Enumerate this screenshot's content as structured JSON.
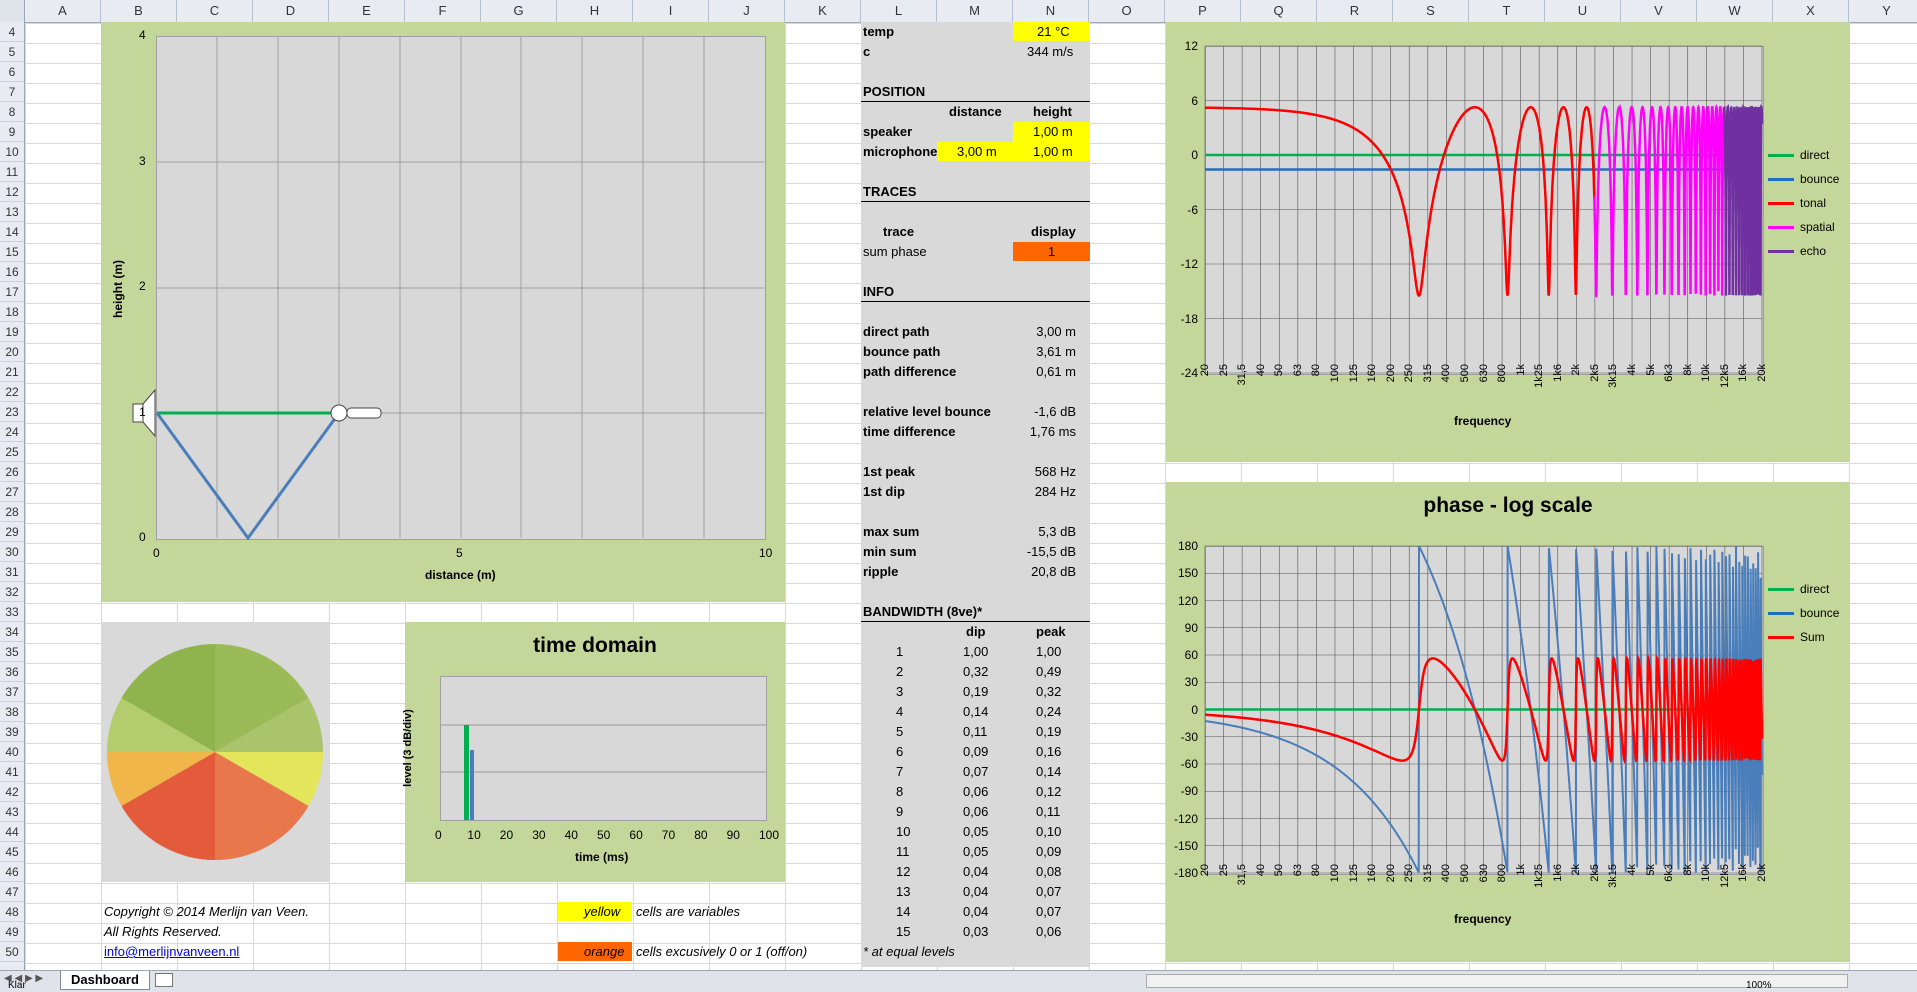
{
  "columns": [
    "A",
    "B",
    "C",
    "D",
    "E",
    "F",
    "G",
    "H",
    "I",
    "J",
    "K",
    "L",
    "M",
    "N",
    "O",
    "P",
    "Q",
    "R",
    "S",
    "T",
    "U",
    "V",
    "W",
    "X",
    "Y"
  ],
  "rows": [
    "4",
    "5",
    "6",
    "7",
    "8",
    "9",
    "10",
    "11",
    "12",
    "13",
    "14",
    "15",
    "16",
    "17",
    "18",
    "19",
    "20",
    "21",
    "22",
    "23",
    "24",
    "25",
    "26",
    "27",
    "28",
    "29",
    "30",
    "31",
    "32",
    "33",
    "34",
    "35",
    "36",
    "37",
    "38",
    "39",
    "40",
    "41",
    "42",
    "43",
    "44",
    "45",
    "46",
    "47",
    "48",
    "49",
    "50"
  ],
  "geometry_chart": {
    "xlabel": "distance (m)",
    "ylabel": "height (m)",
    "xticks": [
      "0",
      "5",
      "10"
    ],
    "yticks": [
      "0",
      "1",
      "2",
      "3",
      "4"
    ]
  },
  "time_chart": {
    "title": "time domain",
    "xlabel": "time (ms)",
    "ylabel": "level (3 dB/div)",
    "xticks": [
      "0",
      "10",
      "20",
      "30",
      "40",
      "50",
      "60",
      "70",
      "80",
      "90",
      "100"
    ]
  },
  "magnitude_chart": {
    "xlabel": "frequency",
    "yticks": [
      "12",
      "6",
      "0",
      "-6",
      "-12",
      "-18",
      "-24"
    ],
    "legend": [
      {
        "name": "direct",
        "color": "#00b050"
      },
      {
        "name": "bounce",
        "color": "#1f6fc0"
      },
      {
        "name": "tonal",
        "color": "#ff0000"
      },
      {
        "name": "spatial",
        "color": "#ff00ff"
      },
      {
        "name": "echo",
        "color": "#7030a0"
      }
    ]
  },
  "phase_chart": {
    "title": "phase - log scale",
    "xlabel": "frequency",
    "yticks": [
      "180",
      "150",
      "120",
      "90",
      "60",
      "30",
      "0",
      "-30",
      "-60",
      "-90",
      "-120",
      "-150",
      "-180"
    ],
    "legend": [
      {
        "name": "direct",
        "color": "#00b050"
      },
      {
        "name": "bounce",
        "color": "#1f6fc0"
      },
      {
        "name": "Sum",
        "color": "#ff0000"
      }
    ]
  },
  "freq_ticks": [
    "20",
    "25",
    "31,5",
    "40",
    "50",
    "63",
    "80",
    "100",
    "125",
    "160",
    "200",
    "250",
    "315",
    "400",
    "500",
    "630",
    "800",
    "1k",
    "1k25",
    "1k6",
    "2k",
    "2k5",
    "3k15",
    "4k",
    "5k",
    "6k3",
    "8k",
    "10k",
    "12k5",
    "16k",
    "20k"
  ],
  "params": {
    "temp_label": "temp",
    "temp_value": "21 °C",
    "c_label": "c",
    "c_value": "344 m/s",
    "position_header": "POSITION",
    "distance_col": "distance",
    "height_col": "height",
    "speaker_label": "speaker",
    "speaker_height": "1,00 m",
    "mic_label": "microphone",
    "mic_distance": "3,00 m",
    "mic_height": "1,00 m",
    "traces_header": "TRACES",
    "trace_col": "trace",
    "display_col": "display",
    "trace_name": "sum phase",
    "trace_display": "1",
    "info_header": "INFO",
    "info": [
      {
        "label": "direct path",
        "value": "3,00 m"
      },
      {
        "label": "bounce path",
        "value": "3,61 m"
      },
      {
        "label": "path difference",
        "value": "0,61 m"
      },
      {
        "label": "relative level bounce",
        "value": "-1,6 dB"
      },
      {
        "label": "time difference",
        "value": "1,76 ms"
      },
      {
        "label": "1st peak",
        "value": "568 Hz"
      },
      {
        "label": "1st dip",
        "value": "284 Hz"
      },
      {
        "label": "max sum",
        "value": "5,3 dB"
      },
      {
        "label": "min sum",
        "value": "-15,5 dB"
      },
      {
        "label": "ripple",
        "value": "20,8 dB"
      }
    ],
    "bw_header": "BANDWIDTH (8ve)*",
    "dip_col": "dip",
    "peak_col": "peak",
    "bandwidth": [
      [
        "1",
        "1,00",
        "1,00"
      ],
      [
        "2",
        "0,32",
        "0,49"
      ],
      [
        "3",
        "0,19",
        "0,32"
      ],
      [
        "4",
        "0,14",
        "0,24"
      ],
      [
        "5",
        "0,11",
        "0,19"
      ],
      [
        "6",
        "0,09",
        "0,16"
      ],
      [
        "7",
        "0,07",
        "0,14"
      ],
      [
        "8",
        "0,06",
        "0,12"
      ],
      [
        "9",
        "0,06",
        "0,11"
      ],
      [
        "10",
        "0,05",
        "0,10"
      ],
      [
        "11",
        "0,05",
        "0,09"
      ],
      [
        "12",
        "0,04",
        "0,08"
      ],
      [
        "13",
        "0,04",
        "0,07"
      ],
      [
        "14",
        "0,04",
        "0,07"
      ],
      [
        "15",
        "0,03",
        "0,06"
      ]
    ],
    "footnote": "* at equal levels"
  },
  "copyright": {
    "line1": "Copyright © 2014 Merlijn van Veen.",
    "line2": "All Rights Reserved.",
    "email": "info@merlijnvanveen.nl"
  },
  "legend_notes": {
    "yellow_word": "yellow",
    "yellow_text": "cells are variables",
    "orange_word": "orange",
    "orange_text": "cells excusively 0 or 1 (off/on)"
  },
  "sheet_tab": "Dashboard",
  "status": {
    "ready": "Klar",
    "zoom": "100%"
  },
  "colors": {
    "panel": "#c4d79b",
    "plot": "#d8d8d8",
    "direct": "#00b050",
    "bounce": "#4a7ebb",
    "sum": "#ff0000"
  }
}
